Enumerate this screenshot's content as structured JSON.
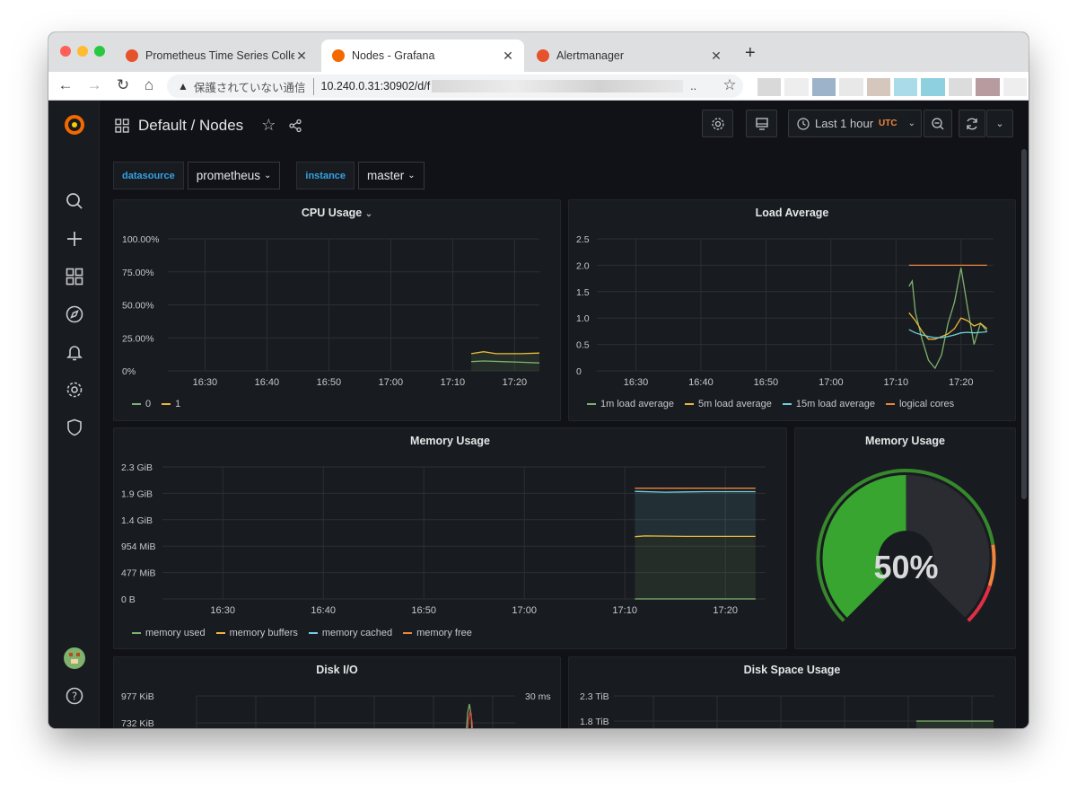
{
  "browser": {
    "tabs": [
      {
        "title": "Prometheus Time Series Collec"
      },
      {
        "title": "Nodes - Grafana"
      },
      {
        "title": "Alertmanager"
      }
    ],
    "address": {
      "security_label": "保護されていない通信",
      "url": "10.240.0.31:30902/d/f"
    }
  },
  "dashboard": {
    "title": "Default / Nodes",
    "time_range": "Last 1 hour",
    "timezone": "UTC",
    "variables": [
      {
        "label": "datasource",
        "value": "prometheus"
      },
      {
        "label": "instance",
        "value": "master"
      }
    ]
  },
  "panels": {
    "cpu": {
      "title": "CPU Usage"
    },
    "load": {
      "title": "Load Average"
    },
    "memory": {
      "title": "Memory Usage"
    },
    "gauge": {
      "title": "Memory Usage",
      "value": "50%"
    },
    "disk_io": {
      "title": "Disk I/O"
    },
    "disk_space": {
      "title": "Disk Space Usage"
    }
  },
  "colors": {
    "green": "#7eb26d",
    "yellow": "#eab839",
    "blue": "#6ed0e0",
    "orange": "#ef843c",
    "red": "#e24d42",
    "gauge_green": "#37872d"
  },
  "chart_data": [
    {
      "type": "line",
      "title": "CPU Usage",
      "x": [
        "16:30",
        "16:40",
        "16:50",
        "17:00",
        "17:10",
        "17:20"
      ],
      "ylim": [
        0,
        100
      ],
      "yticks": [
        "100.00%",
        "75.00%",
        "50.00%",
        "25.00%",
        "0%"
      ],
      "series": [
        {
          "name": "0",
          "color": "#7eb26d",
          "points": [
            [
              "17:13",
              7
            ],
            [
              "17:15",
              7.5
            ],
            [
              "17:18",
              7
            ],
            [
              "17:21",
              6.5
            ],
            [
              "17:24",
              6
            ]
          ]
        },
        {
          "name": "1",
          "color": "#eab839",
          "points": [
            [
              "17:13",
              13
            ],
            [
              "17:15",
              14.5
            ],
            [
              "17:17",
              13
            ],
            [
              "17:21",
              13
            ],
            [
              "17:24",
              13.5
            ]
          ]
        }
      ]
    },
    {
      "type": "line",
      "title": "Load Average",
      "x": [
        "16:30",
        "16:40",
        "16:50",
        "17:00",
        "17:10",
        "17:20"
      ],
      "ylim": [
        0,
        2.5
      ],
      "yticks": [
        "2.5",
        "2.0",
        "1.5",
        "1.0",
        "0.5",
        "0"
      ],
      "series": [
        {
          "name": "1m load average",
          "color": "#7eb26d",
          "points": [
            [
              "17:12",
              1.6
            ],
            [
              "17:12.5",
              1.7
            ],
            [
              "17:13",
              1.1
            ],
            [
              "17:14",
              0.6
            ],
            [
              "17:15",
              0.2
            ],
            [
              "17:16",
              0.05
            ],
            [
              "17:17",
              0.3
            ],
            [
              "17:18",
              0.9
            ],
            [
              "17:19",
              1.3
            ],
            [
              "17:20",
              1.95
            ],
            [
              "17:21",
              1.2
            ],
            [
              "17:22",
              0.5
            ],
            [
              "17:23",
              0.9
            ],
            [
              "17:24",
              0.75
            ]
          ]
        },
        {
          "name": "5m load average",
          "color": "#eab839",
          "points": [
            [
              "17:12",
              1.1
            ],
            [
              "17:13",
              0.95
            ],
            [
              "17:14",
              0.75
            ],
            [
              "17:15",
              0.6
            ],
            [
              "17:16",
              0.6
            ],
            [
              "17:17",
              0.65
            ],
            [
              "17:18",
              0.7
            ],
            [
              "17:19",
              0.8
            ],
            [
              "17:20",
              1.0
            ],
            [
              "17:21",
              0.95
            ],
            [
              "17:22",
              0.85
            ],
            [
              "17:23",
              0.9
            ],
            [
              "17:24",
              0.8
            ]
          ]
        },
        {
          "name": "15m load average",
          "color": "#6ed0e0",
          "points": [
            [
              "17:12",
              0.78
            ],
            [
              "17:13",
              0.72
            ],
            [
              "17:14",
              0.68
            ],
            [
              "17:15",
              0.65
            ],
            [
              "17:16",
              0.63
            ],
            [
              "17:17",
              0.63
            ],
            [
              "17:18",
              0.65
            ],
            [
              "17:19",
              0.68
            ],
            [
              "17:20",
              0.72
            ],
            [
              "17:21",
              0.73
            ],
            [
              "17:22",
              0.72
            ],
            [
              "17:23",
              0.73
            ],
            [
              "17:24",
              0.74
            ]
          ]
        },
        {
          "name": "logical cores",
          "color": "#ef843c",
          "points": [
            [
              "17:12",
              2
            ],
            [
              "17:24",
              2
            ]
          ]
        }
      ]
    },
    {
      "type": "area",
      "title": "Memory Usage",
      "x": [
        "16:30",
        "16:40",
        "16:50",
        "17:00",
        "17:10",
        "17:20"
      ],
      "yticks": [
        "2.3 GiB",
        "1.9 GiB",
        "1.4 GiB",
        "954 MiB",
        "477 MiB",
        "0 B"
      ],
      "ylim_mib": [
        0,
        2355
      ],
      "series": [
        {
          "name": "memory used",
          "color": "#7eb26d",
          "points": [
            [
              "17:11",
              0
            ],
            [
              "17:23",
              0
            ]
          ]
        },
        {
          "name": "memory buffers",
          "color": "#eab839",
          "points": [
            [
              "17:11",
              1110
            ],
            [
              "17:12",
              1125
            ],
            [
              "17:16",
              1115
            ],
            [
              "17:23",
              1115
            ]
          ]
        },
        {
          "name": "memory cached",
          "color": "#6ed0e0",
          "points": [
            [
              "17:11",
              1920
            ],
            [
              "17:14",
              1905
            ],
            [
              "17:18",
              1915
            ],
            [
              "17:23",
              1915
            ]
          ]
        },
        {
          "name": "memory free",
          "color": "#ef843c",
          "points": [
            [
              "17:11",
              1975
            ],
            [
              "17:23",
              1975
            ]
          ]
        }
      ]
    },
    {
      "type": "gauge",
      "title": "Memory Usage",
      "value": 50,
      "unit": "%"
    },
    {
      "type": "line",
      "title": "Disk I/O",
      "yticks": [
        "977 KiB",
        "732 KiB"
      ],
      "y2ticks": [
        "30 ms"
      ],
      "series": []
    },
    {
      "type": "line",
      "title": "Disk Space Usage",
      "yticks": [
        "2.3 TiB",
        "1.8 TiB"
      ],
      "series": []
    }
  ]
}
